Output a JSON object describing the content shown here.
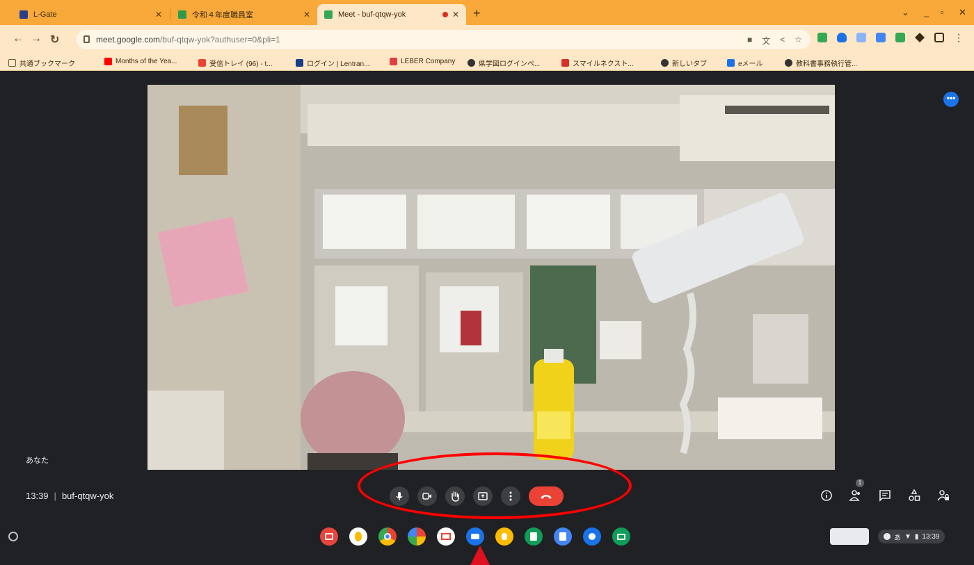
{
  "tabs": [
    {
      "title": "L-Gate",
      "favicon_color": "#2a3f8a",
      "active": false
    },
    {
      "title": "令和４年度職員室",
      "favicon_color": "#2f9b4a",
      "active": false
    },
    {
      "title": "Meet - buf-qtqw-yok",
      "favicon_color": "#34a853",
      "active": true,
      "recording": true
    }
  ],
  "window_controls": [
    "chevron-down-icon",
    "minimize-icon",
    "restore-icon",
    "close-icon"
  ],
  "address_bar": {
    "url_host": "meet.google.com",
    "url_path": "/buf-qtqw-yok?authuser=0&pli=1"
  },
  "bookmarks": [
    {
      "label": "共通ブックマーク",
      "icon": "folder-icon",
      "color": "#6b5a40"
    },
    {
      "label": "Months of the Yea...",
      "icon": "youtube-icon",
      "color": "#ff0000"
    },
    {
      "label": "受信トレイ (96) - t...",
      "icon": "gmail-icon",
      "color": "#ea4335"
    },
    {
      "label": "ログイン | Lentran...",
      "icon": "star-icon",
      "color": "#1a3a8a"
    },
    {
      "label": "LEBER Company",
      "icon": "leber-icon",
      "color": "#e04040"
    },
    {
      "label": "県学図ログインペ...",
      "icon": "globe-icon",
      "color": "#333333"
    },
    {
      "label": "スマイルネクスト...",
      "icon": "smile-icon",
      "color": "#d93025"
    },
    {
      "label": "新しいタブ",
      "icon": "globe-icon",
      "color": "#333333"
    },
    {
      "label": "eメール",
      "icon": "mail-icon",
      "color": "#1a73e8"
    },
    {
      "label": "教科書事務執行管...",
      "icon": "globe-icon",
      "color": "#333333"
    }
  ],
  "meet": {
    "self_label": "あなた",
    "time": "13:39",
    "separator": "|",
    "meeting_code": "buf-qtqw-yok",
    "participant_count": "1",
    "controls": [
      {
        "name": "microphone-button",
        "icon": "microphone-icon"
      },
      {
        "name": "camera-button",
        "icon": "camera-icon"
      },
      {
        "name": "raise-hand-button",
        "icon": "hand-icon"
      },
      {
        "name": "present-button",
        "icon": "present-icon"
      },
      {
        "name": "more-options-button",
        "icon": "more-vert-icon"
      },
      {
        "name": "leave-call-button",
        "icon": "hangup-icon"
      }
    ]
  },
  "shelf": {
    "apps": [
      {
        "icon": "calendar-icon",
        "color": "#e8453c"
      },
      {
        "icon": "banana-icon",
        "color": "#fbbc04"
      },
      {
        "icon": "chrome-icon",
        "color": "#4285f4"
      },
      {
        "icon": "photos-icon",
        "color": "#34a853"
      },
      {
        "icon": "gmail-icon",
        "color": "#ea4335"
      },
      {
        "icon": "meet-icon",
        "color": "#1a73e8"
      },
      {
        "icon": "keep-icon",
        "color": "#fbbc04"
      },
      {
        "icon": "sheets-icon",
        "color": "#0f9d58"
      },
      {
        "icon": "docs-icon",
        "color": "#4285f4"
      },
      {
        "icon": "meet-icon",
        "color": "#1a73e8"
      },
      {
        "icon": "classroom-icon",
        "color": "#0f9d58"
      }
    ],
    "status_time": "13:39",
    "ime": "あ"
  }
}
